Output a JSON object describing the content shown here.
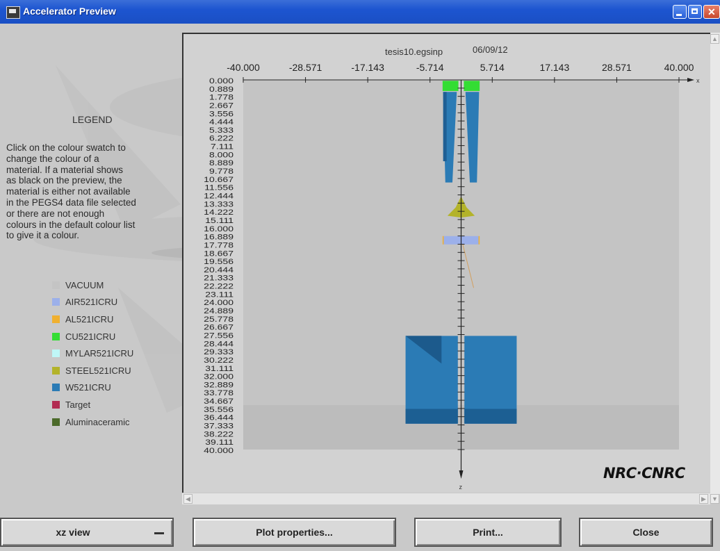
{
  "window": {
    "title": "Accelerator Preview"
  },
  "legend": {
    "title": "LEGEND",
    "description_lines": [
      "Click on the colour swatch to",
      "change the colour of a",
      "material.  If a material shows",
      "as black on the preview,  the",
      "material is either not available",
      "in the PEGS4 data file selected",
      "or there are not enough",
      "colours in the default colour list",
      "to give it a colour."
    ],
    "materials": [
      {
        "name": "VACUUM",
        "color": "#c4c4c4"
      },
      {
        "name": "AIR521ICRU",
        "color": "#9cb0ea"
      },
      {
        "name": "AL521ICRU",
        "color": "#f0b030"
      },
      {
        "name": "CU521ICRU",
        "color": "#33dd33"
      },
      {
        "name": "MYLAR521ICRU",
        "color": "#bff7f7"
      },
      {
        "name": "STEEL521ICRU",
        "color": "#b3b32a"
      },
      {
        "name": "W521ICRU",
        "color": "#2b7bb5"
      },
      {
        "name": "Target",
        "color": "#b22c52"
      },
      {
        "name": "Aluminaceramic",
        "color": "#4b6a2a"
      }
    ]
  },
  "plot": {
    "filename": "tesis10.egsinp",
    "date": "06/09/12",
    "x_axis_label": "x",
    "z_axis_label": "z",
    "x_ticks": [
      "-40.000",
      "-28.571",
      "-17.143",
      "-5.714",
      "5.714",
      "17.143",
      "28.571",
      "40.000"
    ],
    "z_ticks": [
      "0.000",
      "0.889",
      "1.778",
      "2.667",
      "3.556",
      "4.444",
      "5.333",
      "6.222",
      "7.111",
      "8.000",
      "8.889",
      "9.778",
      "10.667",
      "11.556",
      "12.444",
      "13.333",
      "14.222",
      "15.111",
      "16.000",
      "16.889",
      "17.778",
      "18.667",
      "19.556",
      "20.444",
      "21.333",
      "22.222",
      "23.111",
      "24.000",
      "24.889",
      "25.778",
      "26.667",
      "27.556",
      "28.444",
      "29.333",
      "30.222",
      "31.111",
      "32.000",
      "32.889",
      "33.778",
      "34.667",
      "35.556",
      "36.444",
      "37.333",
      "38.222",
      "39.111",
      "40.000"
    ],
    "logo": "NRC·CNRC"
  },
  "buttons": {
    "view_select": "xz view",
    "plot_properties": "Plot properties...",
    "print": "Print...",
    "close": "Close"
  }
}
